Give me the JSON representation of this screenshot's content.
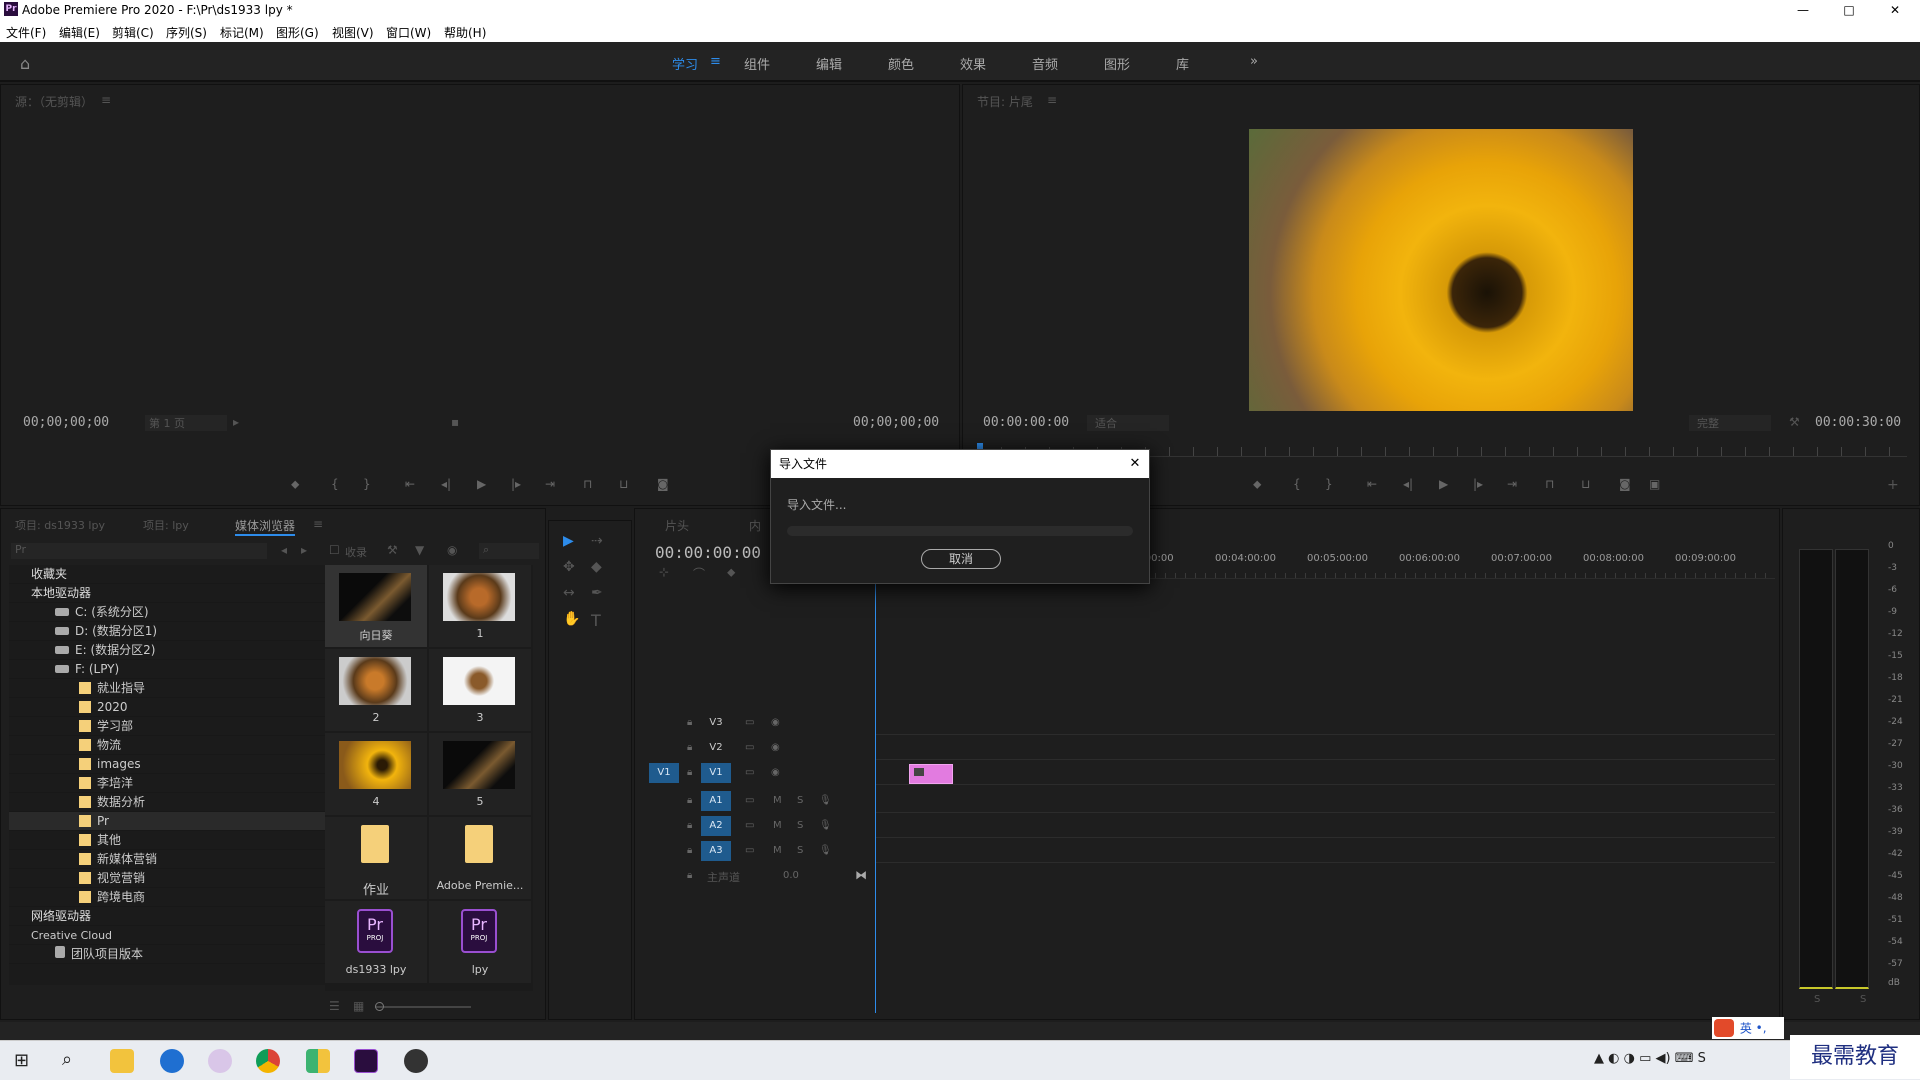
{
  "window": {
    "title": "Adobe Premiere Pro 2020 - F:\\Pr\\ds1933 lpy *",
    "app_badge": "Pr",
    "controls": [
      "—",
      "□",
      "✕"
    ]
  },
  "menu": [
    "文件(F)",
    "编辑(E)",
    "剪辑(C)",
    "序列(S)",
    "标记(M)",
    "图形(G)",
    "视图(V)",
    "窗口(W)",
    "帮助(H)"
  ],
  "workspaces": {
    "tabs": [
      "学习",
      "组件",
      "编辑",
      "颜色",
      "效果",
      "音频",
      "图形",
      "库"
    ],
    "active": "学习",
    "menu_glyph": "≡",
    "overflow": "»"
  },
  "source_monitor": {
    "title": "源：（无剪辑）",
    "tab_menu": "≡",
    "timecode_left": "00;00;00;00",
    "page_select": "第 1 页",
    "timecode_right": "00;00;00;00"
  },
  "program_monitor": {
    "title": "节目: 片尾",
    "tab_menu": "≡",
    "timecode_left": "00:00:00:00",
    "fit_select": "适合",
    "quality_select": "完整",
    "timecode_right": "00:00:30:00"
  },
  "project_panel": {
    "tabs": [
      "项目: ds1933 lpy",
      "项目: lpy",
      "媒体浏览器"
    ],
    "active_tab": "媒体浏览器",
    "tab_menu": "≡",
    "path_select": "Pr",
    "ingest_label": "收录",
    "tree": [
      {
        "label": "收藏夹",
        "level": 0,
        "kind": "header"
      },
      {
        "label": "本地驱动器",
        "level": 0,
        "kind": "header"
      },
      {
        "label": "C: (系统分区)",
        "level": 1,
        "kind": "drive"
      },
      {
        "label": "D: (数据分区1)",
        "level": 1,
        "kind": "drive"
      },
      {
        "label": "E: (数据分区2)",
        "level": 1,
        "kind": "drive"
      },
      {
        "label": "F: (LPY)",
        "level": 1,
        "kind": "drive"
      },
      {
        "label": "就业指导",
        "level": 2,
        "kind": "folder"
      },
      {
        "label": "2020",
        "level": 2,
        "kind": "folder"
      },
      {
        "label": "学习部",
        "level": 2,
        "kind": "folder"
      },
      {
        "label": "物流",
        "level": 2,
        "kind": "folder"
      },
      {
        "label": "images",
        "level": 2,
        "kind": "folder"
      },
      {
        "label": "李培洋",
        "level": 2,
        "kind": "folder"
      },
      {
        "label": "数据分析",
        "level": 2,
        "kind": "folder"
      },
      {
        "label": "Pr",
        "level": 2,
        "kind": "folder",
        "selected": true
      },
      {
        "label": "其他",
        "level": 2,
        "kind": "folder"
      },
      {
        "label": "新媒体营销",
        "level": 2,
        "kind": "folder"
      },
      {
        "label": "视觉营销",
        "level": 2,
        "kind": "folder"
      },
      {
        "label": "跨境电商",
        "level": 2,
        "kind": "folder"
      },
      {
        "label": "网络驱动器",
        "level": 0,
        "kind": "header"
      },
      {
        "label": "Creative Cloud",
        "level": 0,
        "kind": "header"
      },
      {
        "label": "团队项目版本",
        "level": 1,
        "kind": "team"
      }
    ],
    "thumbnails": [
      {
        "label": "向日葵",
        "kind": "dark-photo"
      },
      {
        "label": "1",
        "kind": "food-photo"
      },
      {
        "label": "2",
        "kind": "food-photo"
      },
      {
        "label": "3",
        "kind": "bowl-photo"
      },
      {
        "label": "4",
        "kind": "sunflower-photo"
      },
      {
        "label": "5",
        "kind": "dark-photo"
      },
      {
        "label": "作业",
        "kind": "folder"
      },
      {
        "label": "Adobe Premie...",
        "kind": "folder"
      },
      {
        "label": "ds1933 lpy",
        "kind": "proj"
      },
      {
        "label": "lpy",
        "kind": "proj"
      }
    ],
    "proj_icon_text": "Pr",
    "proj_icon_sub": "PROJ"
  },
  "timeline": {
    "tabs": [
      "片头",
      "内"
    ],
    "timecode": "00:00:00:00",
    "ruler": [
      "0:00:00",
      "00:04:00:00",
      "00:05:00:00",
      "00:06:00:00",
      "00:07:00:00",
      "00:08:00:00",
      "00:09:00:00"
    ],
    "video_tracks": [
      "V3",
      "V2",
      "V1"
    ],
    "audio_tracks": [
      "A1",
      "A2",
      "A3"
    ],
    "source_patch": "V1",
    "master_label": "主声道",
    "master_value": "0.0",
    "mute": "M",
    "solo": "S"
  },
  "audio_meter": {
    "ticks": [
      "0",
      "-3",
      "-6",
      "-9",
      "-12",
      "-15",
      "-18",
      "-21",
      "-24",
      "-27",
      "-30",
      "-33",
      "-36",
      "-39",
      "-42",
      "-45",
      "-48",
      "-51",
      "-54",
      "-57",
      "dB"
    ],
    "solo_left": "S",
    "solo_right": "S"
  },
  "dialog": {
    "title": "导入文件",
    "message": "导入文件...",
    "cancel_label": "取消",
    "close_glyph": "✕",
    "progress": 0
  },
  "tools": [
    "▶",
    "⇢",
    "✥",
    "◆",
    "↔",
    "✒",
    "✋",
    "T"
  ],
  "taskbar": {
    "ime_label": "英",
    "ime_punct": "•,",
    "watermark": "最需教育"
  },
  "colors": {
    "accent": "#2d8ceb",
    "timeline_blue": "#1f5b8e",
    "clip_pink": "#e27be0",
    "folder_yellow": "#f5d07a",
    "proj_purple": "#9a4fd1"
  }
}
